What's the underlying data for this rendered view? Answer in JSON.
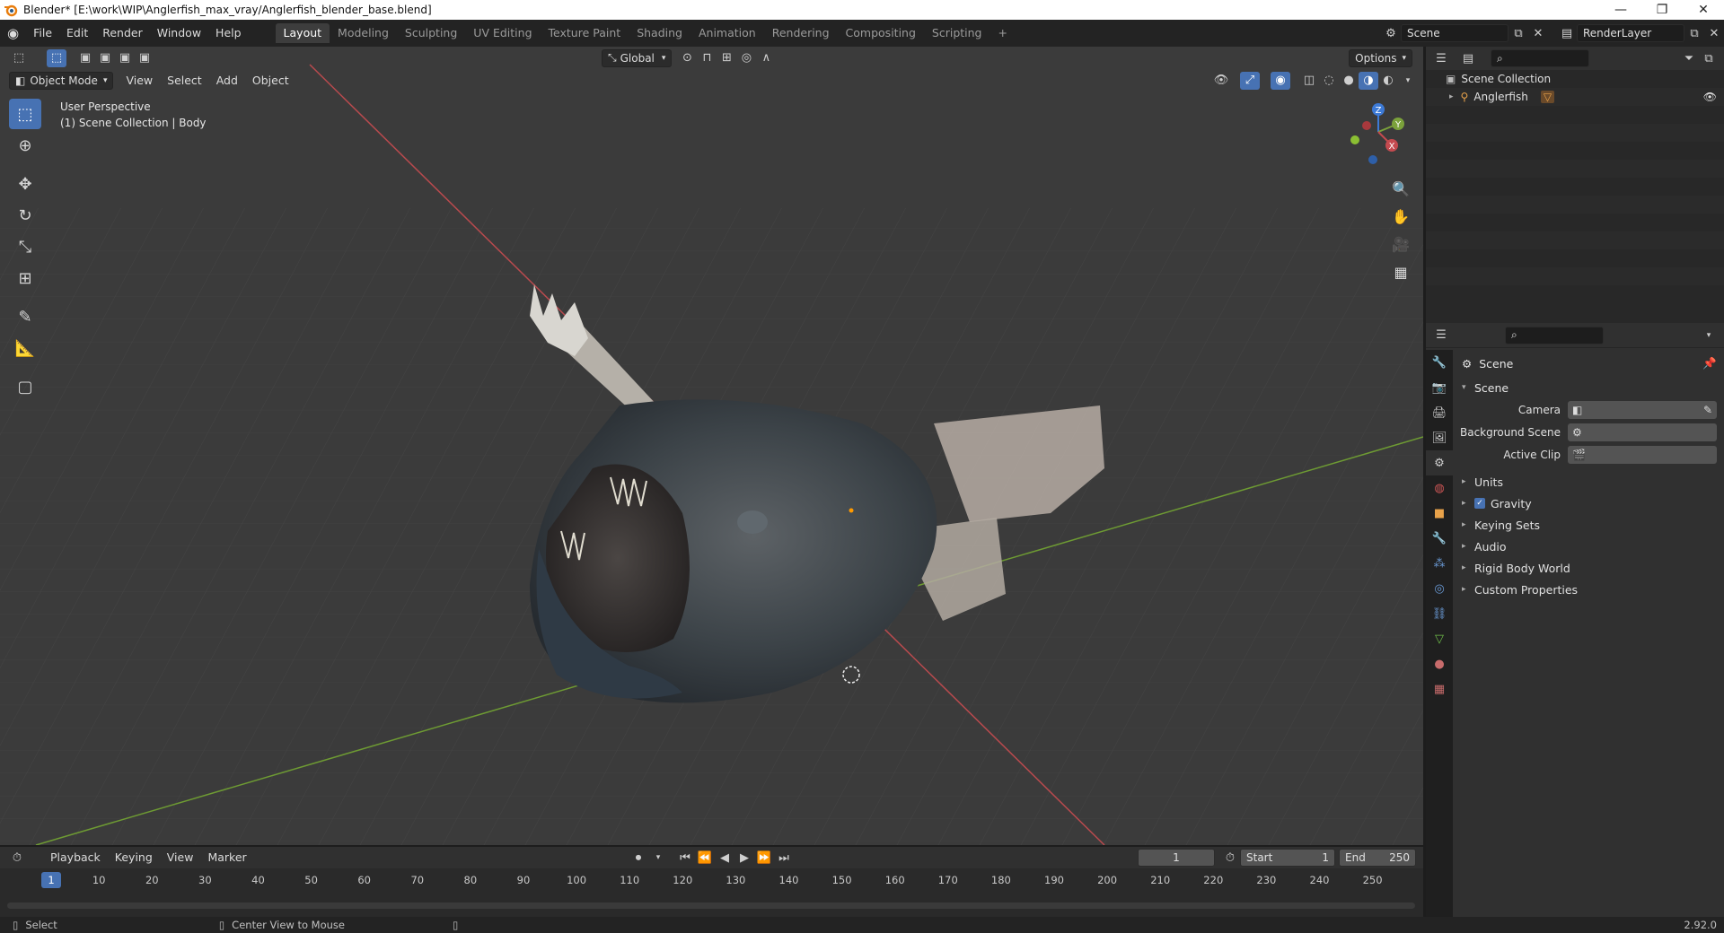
{
  "window": {
    "title": "Blender* [E:\\work\\WIP\\Anglerfish_max_vray/Anglerfish_blender_base.blend]",
    "minimize": "—",
    "maximize": "❐",
    "close": "✕"
  },
  "menu": {
    "items": [
      "File",
      "Edit",
      "Render",
      "Window",
      "Help"
    ]
  },
  "workspaces": {
    "tabs": [
      "Layout",
      "Modeling",
      "Sculpting",
      "UV Editing",
      "Texture Paint",
      "Shading",
      "Animation",
      "Rendering",
      "Compositing",
      "Scripting"
    ],
    "active": "Layout",
    "add": "+"
  },
  "scene_selector": {
    "value": "Scene"
  },
  "renderlayer_selector": {
    "value": "RenderLayer"
  },
  "viewport_header": {
    "mode": "Object Mode",
    "menus": [
      "View",
      "Select",
      "Add",
      "Object"
    ],
    "orientation": "Global",
    "options": "Options"
  },
  "viewport_info": {
    "perspective": "User Perspective",
    "collection": "(1) Scene Collection | Body"
  },
  "gizmo": {
    "z": "Z",
    "y": "Y",
    "x": "X"
  },
  "outliner": {
    "root": "Scene Collection",
    "items": [
      {
        "label": "Anglerfish"
      }
    ]
  },
  "properties": {
    "context": "Scene",
    "panel_title": "Scene",
    "fields": [
      {
        "label": "Camera",
        "value": ""
      },
      {
        "label": "Background Scene",
        "value": ""
      },
      {
        "label": "Active Clip",
        "value": ""
      }
    ],
    "subpanels": [
      "Units",
      "Gravity",
      "Keying Sets",
      "Audio",
      "Rigid Body World",
      "Custom Properties"
    ],
    "gravity_checked": true
  },
  "timeline": {
    "menus": [
      "Playback",
      "Keying",
      "View",
      "Marker"
    ],
    "current_frame": "1",
    "start_label": "Start",
    "start": "1",
    "end_label": "End",
    "end": "250",
    "ruler": [
      "1",
      "10",
      "20",
      "30",
      "40",
      "50",
      "60",
      "70",
      "80",
      "90",
      "100",
      "110",
      "120",
      "130",
      "140",
      "150",
      "160",
      "170",
      "180",
      "190",
      "200",
      "210",
      "220",
      "230",
      "240",
      "250"
    ]
  },
  "statusbar": {
    "left": "Select",
    "middle": "Center View to Mouse",
    "version": "2.92.0"
  },
  "colors": {
    "accent": "#4772b3",
    "x_axis": "#c44a4f",
    "y_axis": "#7ba13b",
    "z_axis": "#3d7ad6"
  }
}
